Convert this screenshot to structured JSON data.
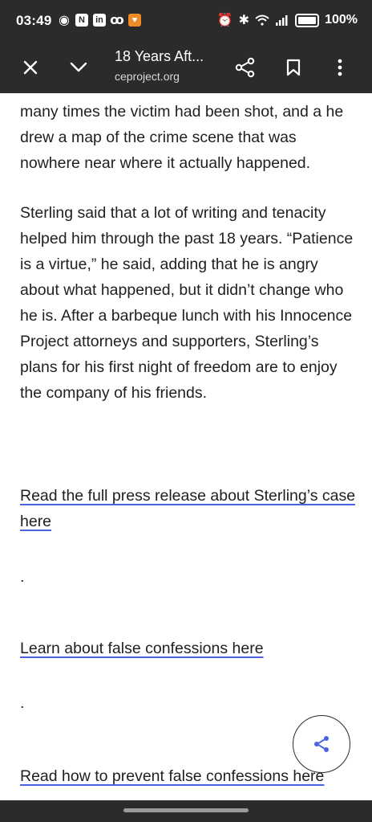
{
  "status_bar": {
    "time": "03:49",
    "battery": "100%",
    "icons": [
      "eye-icon",
      "nfc-n-icon",
      "linkedin-icon",
      "voicemail-icon",
      "heart-app-icon",
      "alarm-icon",
      "bluetooth-icon",
      "wifi-icon",
      "signal-icon",
      "battery-icon"
    ]
  },
  "toolbar": {
    "title": "18 Years Aft...",
    "url": "ceproject.org",
    "icons": [
      "close-icon",
      "chevron-down-icon",
      "share-icon",
      "bookmark-icon",
      "more-vert-icon"
    ]
  },
  "article": {
    "paragraph_1": "many times the victim had been shot, and a he drew a map of the crime scene that was nowhere near where it actually happened.",
    "paragraph_2": "Sterling said that a lot of writing and tenacity helped him through the past 18 years.  “Patience is a virtue,” he said, adding that he is angry about what happened, but it didn’t change who he is. After a barbeque lunch with his Innocence Project attorneys and supporters, Sterling’s plans for his first night of freedom are to enjoy the company of his friends.",
    "link_1": "Read the full press release about Sterling’s case here",
    "separator_1": ".",
    "link_2": "Learn about false confessions here",
    "separator_2": ".",
    "link_3": "Read how to prevent false confessions here"
  },
  "colors": {
    "chrome_bg": "#2b2b2b",
    "link_underline": "#4a63e0",
    "share_icon": "#4a63e0"
  }
}
